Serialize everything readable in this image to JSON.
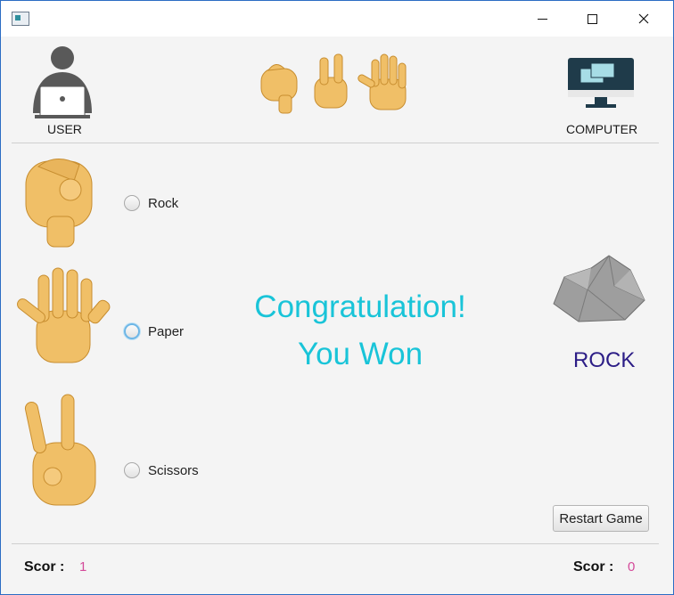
{
  "window": {
    "min_label": "minimize",
    "max_label": "maximize",
    "close_label": "close"
  },
  "header": {
    "user_label": "USER",
    "computer_label": "COMPUTER"
  },
  "choices": [
    {
      "label": "Rock"
    },
    {
      "label": "Paper"
    },
    {
      "label": "Scissors"
    }
  ],
  "result": {
    "line1": "Congratulation!",
    "line2": "You Won",
    "computer_choice": "ROCK"
  },
  "restart_label": "Restart Game",
  "footer": {
    "user_score_label": "Scor :",
    "user_score": "1",
    "computer_score_label": "Scor :",
    "computer_score": "0"
  },
  "colors": {
    "message": "#19c4d8",
    "computer_choice": "#2c1d86",
    "score_value": "#d44a9a",
    "hand": "#f0bf67"
  }
}
